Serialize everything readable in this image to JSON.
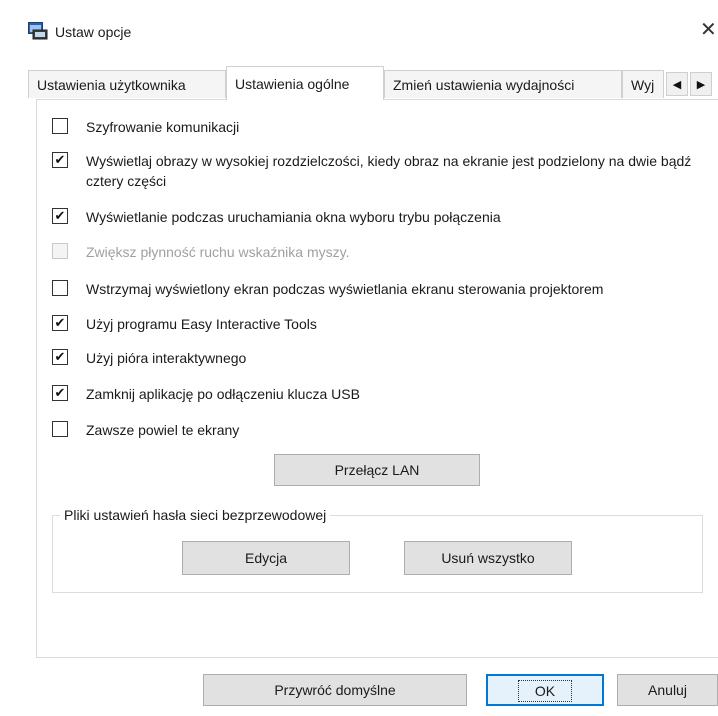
{
  "window": {
    "title": "Ustaw opcje",
    "close_glyph": "✕",
    "icon": "app-window-icon"
  },
  "tabs": [
    {
      "label": "Ustawienia użytkownika",
      "active": false
    },
    {
      "label": "Ustawienia ogólne",
      "active": true
    },
    {
      "label": "Zmień ustawienia wydajności",
      "active": false
    },
    {
      "label": "Wyj",
      "active": false
    }
  ],
  "tab_scroll": {
    "left": "◀",
    "right": "▶"
  },
  "options": [
    {
      "label": "Szyfrowanie komunikacji",
      "checked": false,
      "enabled": true
    },
    {
      "label": "Wyświetlaj obrazy w wysokiej rozdzielczości, kiedy obraz na ekranie jest podzielony na dwie bądź cztery części",
      "checked": true,
      "enabled": true
    },
    {
      "label": "Wyświetlanie podczas uruchamiania okna wyboru trybu połączenia",
      "checked": true,
      "enabled": true
    },
    {
      "label": "Zwiększ płynność ruchu wskaźnika myszy.",
      "checked": false,
      "enabled": false
    },
    {
      "label": "Wstrzymaj wyświetlony ekran podczas wyświetlania ekranu sterowania projektorem",
      "checked": false,
      "enabled": true
    },
    {
      "label": "Użyj programu Easy Interactive Tools",
      "checked": true,
      "enabled": true
    },
    {
      "label": "Użyj pióra interaktywnego",
      "checked": true,
      "enabled": true
    },
    {
      "label": "Zamknij aplikację po odłączeniu klucza USB",
      "checked": true,
      "enabled": true
    },
    {
      "label": "Zawsze powiel te ekrany",
      "checked": false,
      "enabled": true
    }
  ],
  "check_glyph": "✔",
  "buttons": {
    "switch_lan": "Przełącz LAN",
    "edit": "Edycja",
    "delete_all": "Usuń wszystko",
    "restore_defaults": "Przywróć domyślne",
    "ok": "OK",
    "cancel": "Anuluj"
  },
  "wireless_group": {
    "legend": "Pliki ustawień hasła sieci bezprzewodowej"
  },
  "colors": {
    "accent": "#0078d7",
    "button_face": "#e1e1e1",
    "disabled_text": "#a0a0a0"
  }
}
